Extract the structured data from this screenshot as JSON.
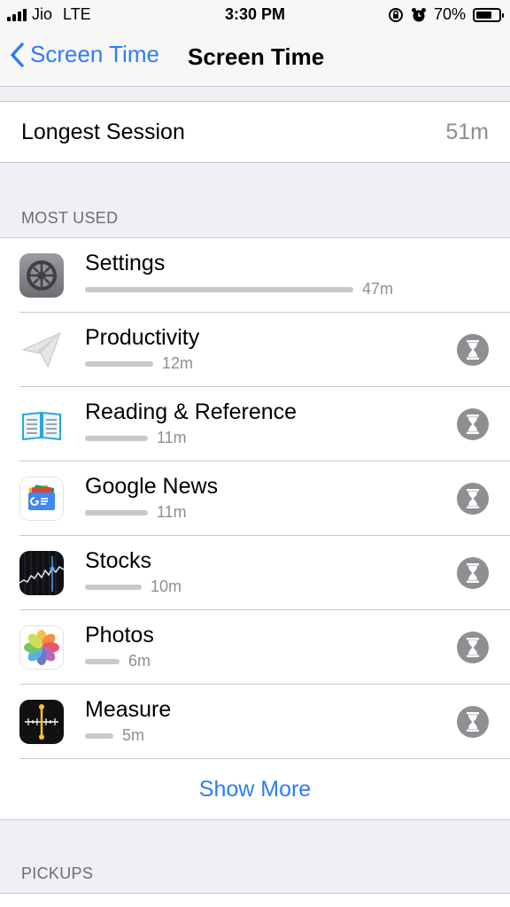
{
  "status_bar": {
    "carrier": "Jio",
    "network": "LTE",
    "time": "3:30 PM",
    "battery": "70%",
    "battery_level": 0.7
  },
  "nav": {
    "back_label": "Screen Time",
    "title": "Screen Time"
  },
  "longest_session": {
    "label": "Longest Session",
    "value": "51m"
  },
  "most_used": {
    "header": "MOST USED",
    "apps": [
      {
        "name": "Settings",
        "time": "47m",
        "minutes": 47,
        "icon": "settings-icon"
      },
      {
        "name": "Productivity",
        "time": "12m",
        "minutes": 12,
        "icon": "paper-plane-icon"
      },
      {
        "name": "Reading & Reference",
        "time": "11m",
        "minutes": 11,
        "icon": "book-icon"
      },
      {
        "name": "Google News",
        "time": "11m",
        "minutes": 11,
        "icon": "google-news-icon"
      },
      {
        "name": "Stocks",
        "time": "10m",
        "minutes": 10,
        "icon": "stocks-icon"
      },
      {
        "name": "Photos",
        "time": "6m",
        "minutes": 6,
        "icon": "photos-icon"
      },
      {
        "name": "Measure",
        "time": "5m",
        "minutes": 5,
        "icon": "measure-icon"
      }
    ],
    "show_more": "Show More"
  },
  "pickups": {
    "header": "PICKUPS"
  },
  "colors": {
    "accent": "#2f7cf6",
    "background": "#efeff4",
    "secondary_text": "#8e8e93",
    "bar": "#c7c7cc"
  }
}
